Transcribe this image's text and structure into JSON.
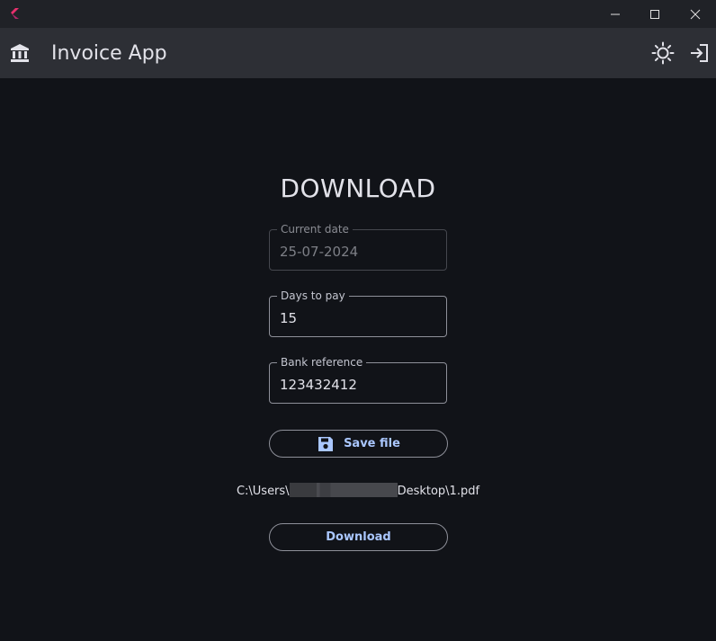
{
  "window": {
    "controls": {
      "minimize": "minimize",
      "maximize": "maximize",
      "close": "close"
    }
  },
  "appbar": {
    "title": "Invoice App",
    "icons": {
      "left": "bank-icon",
      "theme": "sun-icon",
      "logout": "logout-icon"
    }
  },
  "main": {
    "title": "DOWNLOAD",
    "fields": {
      "current_date": {
        "label": "Current date",
        "value": "25-07-2024",
        "disabled": true
      },
      "days_to_pay": {
        "label": "Days to pay",
        "value": "15"
      },
      "bank_reference": {
        "label": "Bank reference",
        "value": "123432412"
      }
    },
    "save_button": {
      "label": "Save file",
      "icon": "save-icon"
    },
    "file_path": {
      "prefix": "C:\\Users\\",
      "suffix": "Desktop\\1.pdf"
    },
    "download_button": {
      "label": "Download"
    }
  },
  "colors": {
    "background": "#111318",
    "appbar": "#2d2f35",
    "titlebar": "#202227",
    "accent": "#aac7ff",
    "outline": "#8e9099"
  }
}
